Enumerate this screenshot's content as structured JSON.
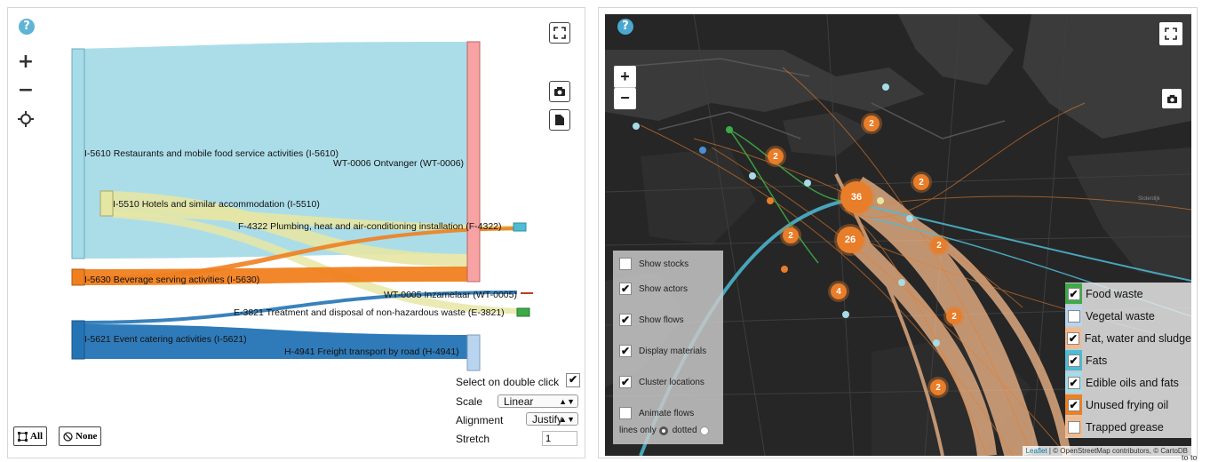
{
  "sankey": {
    "nodes": {
      "restaurants": "I-5610 Restaurants and mobile food service activities (I-5610)",
      "hotels": "I-5510 Hotels and similar accommodation (I-5510)",
      "beverage": "I-5630 Beverage serving activities (I-5630)",
      "catering": "I-5621 Event catering activities (I-5621)",
      "ontvanger": "WT-0006 Ontvanger (WT-0006)",
      "plumbing": "F-4322 Plumbing, heat and air-conditioning installation (F-4322)",
      "inzamelaar": "WT-0005 Inzamelaar (WT-0005)",
      "disposal": "E-3821 Treatment and disposal of non-hazardous waste (E-3821)",
      "freight": "H-4941 Freight transport by road (H-4941)"
    },
    "colors": {
      "restaurants": "#a6dbe8",
      "hotels": "#e6e6a4",
      "beverage": "#f07f1f",
      "catering": "#2474b5",
      "ontvanger": "#f7a3a3",
      "freight": "#b8d4ef",
      "plumbing": "#4dbcd4",
      "inzamelaar": "#c0392b",
      "disposal": "#3daa47"
    },
    "controls": {
      "select_on_double_click": "Select on double click",
      "scale_label": "Scale",
      "scale_value": "Linear",
      "alignment_label": "Alignment",
      "alignment_value": "Justify",
      "stretch_label": "Stretch",
      "stretch_value": "1"
    },
    "buttons": {
      "all": "All",
      "none": "None"
    }
  },
  "map": {
    "zoom_in": "+",
    "zoom_out": "−",
    "layers": {
      "show_stocks": "Show stocks",
      "show_actors": "Show actors",
      "show_flows": "Show flows",
      "display_materials": "Display materials",
      "cluster_locations": "Cluster locations",
      "animate_flows": "Animate flows",
      "lines_only": "lines only",
      "dotted": "dotted"
    },
    "legend": [
      {
        "label": "Food waste",
        "color": "#3daa47",
        "checked": true
      },
      {
        "label": "Vegetal waste",
        "color": "#b8d4ef",
        "checked": false
      },
      {
        "label": "Fat, water and sludge",
        "color": "#f5b98a",
        "checked": true
      },
      {
        "label": "Fats",
        "color": "#4dbcd4",
        "checked": true
      },
      {
        "label": "Edible oils and fats",
        "color": "#a6dbe8",
        "checked": true
      },
      {
        "label": "Unused frying oil",
        "color": "#f07f1f",
        "checked": true
      },
      {
        "label": "Trapped grease",
        "color": "#f5b98a",
        "checked": false
      }
    ],
    "clusters": [
      "2",
      "2",
      "2",
      "36",
      "2",
      "26",
      "2",
      "4",
      "2",
      "2"
    ],
    "attribution": {
      "leaflet": "Leaflet",
      "rest": " | © OpenStreetMap contributors, © CartoDB"
    }
  },
  "page_footer": "to to"
}
